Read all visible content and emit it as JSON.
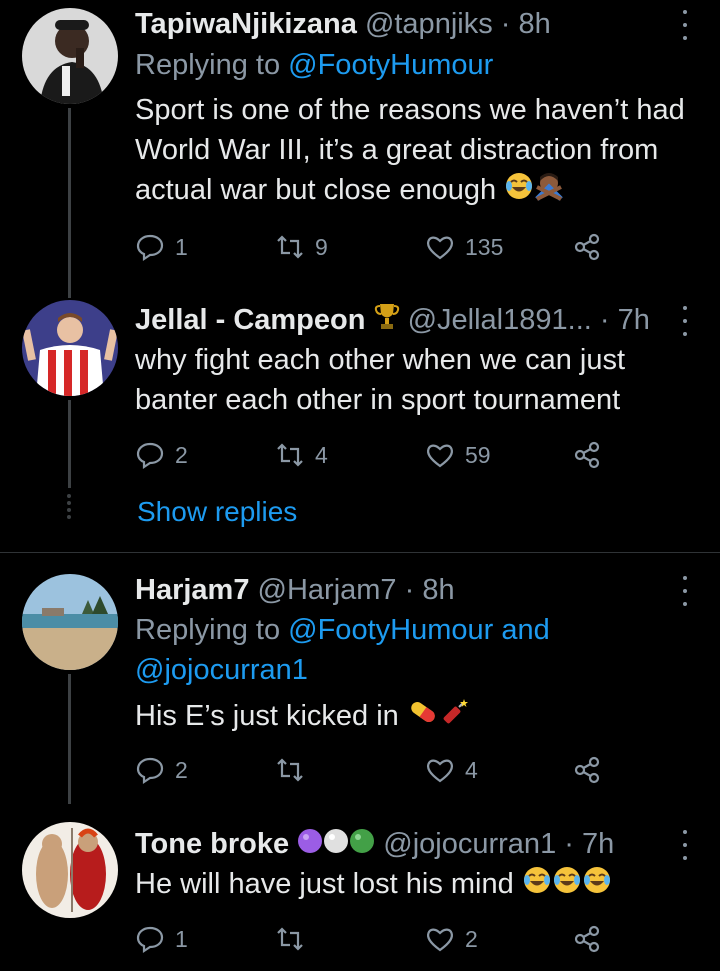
{
  "tweets": [
    {
      "name": "TapiwaNjikizana",
      "handle": "@tapnjiks",
      "time": "· 8h",
      "replying_prefix": "Replying to",
      "replying_mentions": "@FootyHumour",
      "text_lines": [
        "Sport is one of the reasons we haven’t had",
        "World War III, it’s a great distraction from",
        "actual war but close enough"
      ],
      "emoji": [
        "face-with-tears-of-joy",
        "person-gesturing-no"
      ],
      "replies": "1",
      "retweets": "9",
      "likes": "135"
    },
    {
      "name": "Jellal - Campeon",
      "handle": "@Jellal1891...",
      "time": "· 7h",
      "badge": "trophy",
      "text_lines": [
        "why fight each other when we can just",
        "banter each other in sport tournament"
      ],
      "replies": "2",
      "retweets": "4",
      "likes": "59",
      "show_replies": "Show replies"
    },
    {
      "name": "Harjam7",
      "handle": "@Harjam7",
      "time": "· 8h",
      "replying_prefix": "Replying to",
      "replying_mentions": "@FootyHumour and",
      "replying_mentions_2": "@jojocurran1",
      "text_lines": [
        "His E’s just kicked in"
      ],
      "emoji": [
        "pill",
        "firecracker"
      ],
      "replies": "2",
      "retweets": "",
      "likes": "4"
    },
    {
      "name": "Tone broke",
      "handle": "@jojocurran1",
      "time": "· 7h",
      "badges": [
        "purple-circle",
        "white-circle",
        "green-circle"
      ],
      "text_lines": [
        "He will have just lost his mind"
      ],
      "emoji": [
        "face-with-tears-of-joy",
        "face-with-tears-of-joy",
        "face-with-tears-of-joy"
      ],
      "replies": "1",
      "retweets": "",
      "likes": "2"
    }
  ],
  "colors": {
    "background": "#000000",
    "text": "#e7e9ea",
    "secondary": "#8b98a5",
    "link": "#1d9bf0",
    "divider": "#2f3336"
  }
}
